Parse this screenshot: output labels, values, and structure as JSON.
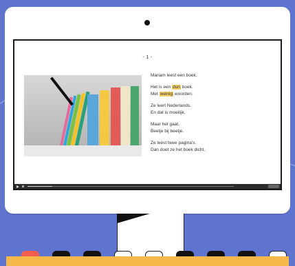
{
  "page": {
    "page_number": "- 1 -"
  },
  "story": {
    "line1": "Mariam leest een boek.",
    "line2_prefix": "Het is een ",
    "line2_highlight": "dun",
    "line2_suffix": " boek.",
    "line3_prefix": "Met ",
    "line3_highlight": "weinig",
    "line3_suffix": " woorden.",
    "line4": "Ze leert Nederlands.",
    "line5": "En dat is moeilijk.",
    "line6": "Maar het gaat.",
    "line7": "Beetje bij beetje.",
    "line8": "Ze leest twee pagina's.",
    "line9": "Dan doet ze het boek dicht."
  },
  "player": {
    "progress_fraction": 0.12
  },
  "colors": {
    "background": "#5f74cf",
    "highlight": "#f6d16a",
    "keyboard_strip": "#f6b84b",
    "red_key": "#f15d4f"
  },
  "icons": {
    "play": "play-icon",
    "volume": "volume-icon"
  }
}
